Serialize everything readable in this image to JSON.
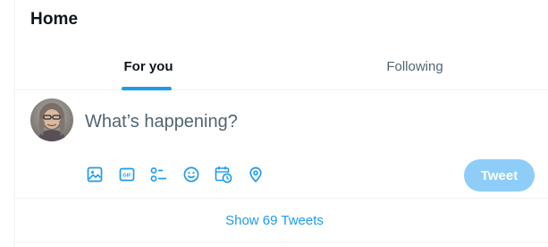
{
  "header": {
    "title": "Home"
  },
  "tabs": [
    {
      "label": "For you",
      "active": true
    },
    {
      "label": "Following",
      "active": false
    }
  ],
  "composer": {
    "placeholder": "What’s happening?",
    "value": "",
    "tools": [
      {
        "icon": "image-icon"
      },
      {
        "icon": "gif-icon"
      },
      {
        "icon": "poll-icon"
      },
      {
        "icon": "emoji-icon"
      },
      {
        "icon": "schedule-icon"
      },
      {
        "icon": "location-icon"
      }
    ],
    "gif_badge": "GIF",
    "tweet_label": "Tweet"
  },
  "feed": {
    "show_more_label": "Show 69 Tweets"
  },
  "colors": {
    "accent": "#1d9bf0",
    "tweet_button_disabled": "#8ecdf8",
    "border": "#eff3f4",
    "text_primary": "#0f1419",
    "text_secondary": "#536471"
  }
}
